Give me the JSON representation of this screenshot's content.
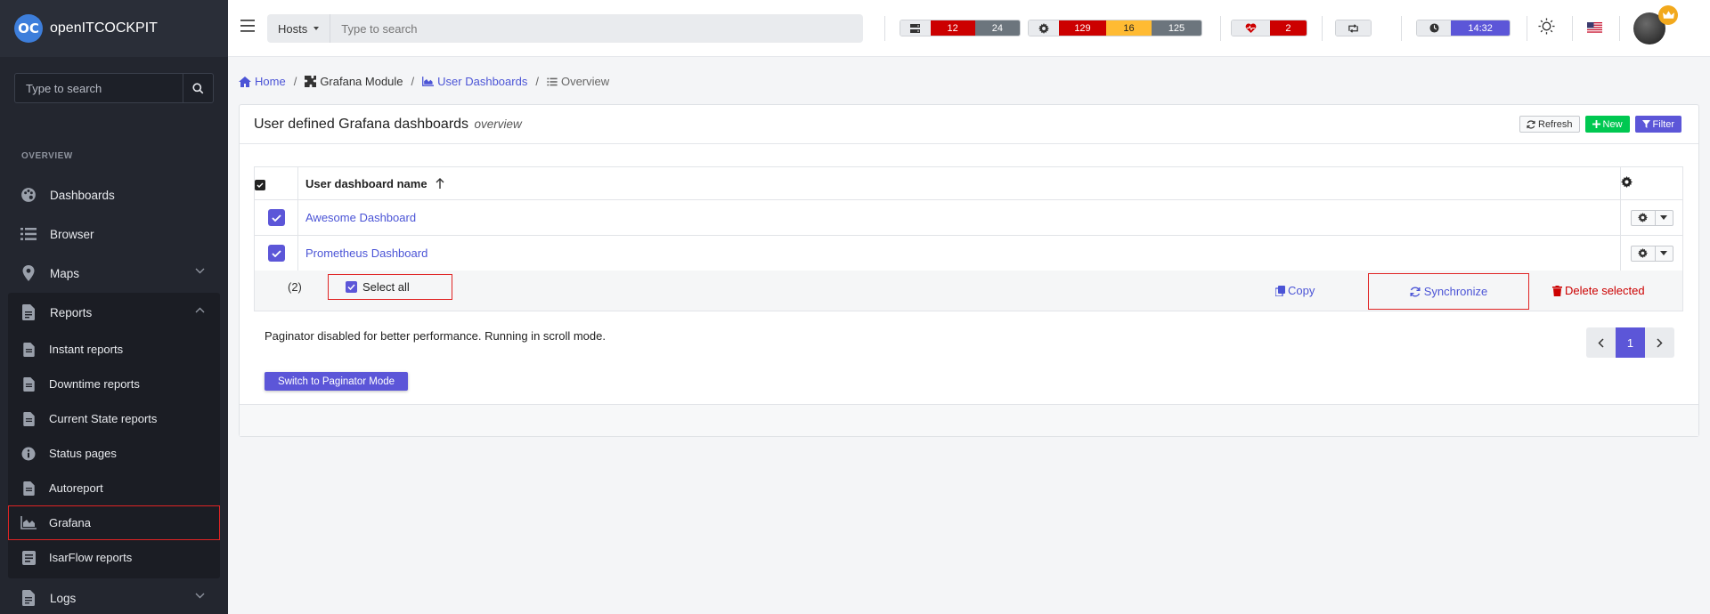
{
  "brand": {
    "name": "openITCOCKPIT",
    "logo_text": "OC"
  },
  "sidebar": {
    "search_placeholder": "Type to search",
    "section_title": "OVERVIEW",
    "items": [
      {
        "label": "Dashboards",
        "icon": "palette-icon"
      },
      {
        "label": "Browser",
        "icon": "list-icon"
      },
      {
        "label": "Maps",
        "icon": "map-marker-icon"
      }
    ],
    "reports": {
      "label": "Reports",
      "sub_items": [
        {
          "label": "Instant reports",
          "icon": "file-icon"
        },
        {
          "label": "Downtime reports",
          "icon": "file-icon"
        },
        {
          "label": "Current State reports",
          "icon": "file-icon"
        },
        {
          "label": "Status pages",
          "icon": "info-icon"
        },
        {
          "label": "Autoreport",
          "icon": "file-icon"
        },
        {
          "label": "Grafana",
          "icon": "area-chart-icon"
        },
        {
          "label": "IsarFlow reports",
          "icon": "report-icon"
        }
      ]
    },
    "logs": {
      "label": "Logs"
    }
  },
  "topbar": {
    "search_type": "Hosts",
    "search_placeholder": "Type to search",
    "host_stats": {
      "down": "12",
      "unreachable": "24"
    },
    "service_stats": {
      "critical": "129",
      "warning": "16",
      "unknown": "125"
    },
    "health": {
      "count": "2"
    },
    "time": "14:32"
  },
  "breadcrumb": {
    "home": "Home",
    "module": "Grafana Module",
    "user_dashboards": "User Dashboards",
    "overview": "Overview"
  },
  "card": {
    "title": "User defined Grafana dashboards",
    "subtitle": "overview",
    "buttons": {
      "refresh": "Refresh",
      "new": "New",
      "filter": "Filter"
    },
    "table": {
      "column_name": "User dashboard name",
      "rows": [
        {
          "name": "Awesome Dashboard"
        },
        {
          "name": "Prometheus Dashboard"
        }
      ]
    },
    "mass": {
      "count": "(2)",
      "select_all": "Select all",
      "copy": "Copy",
      "synchronize": "Synchronize",
      "delete": "Delete selected"
    },
    "scroll_message": "Paginator disabled for better performance. Running in scroll mode.",
    "page": "1",
    "switch_button": "Switch to Paginator Mode"
  },
  "colors": {
    "accent": "#5c56d8",
    "danger": "#cc0000",
    "success": "#00c851",
    "warning": "#ffbb33",
    "sidebar_bg": "#23262f"
  }
}
